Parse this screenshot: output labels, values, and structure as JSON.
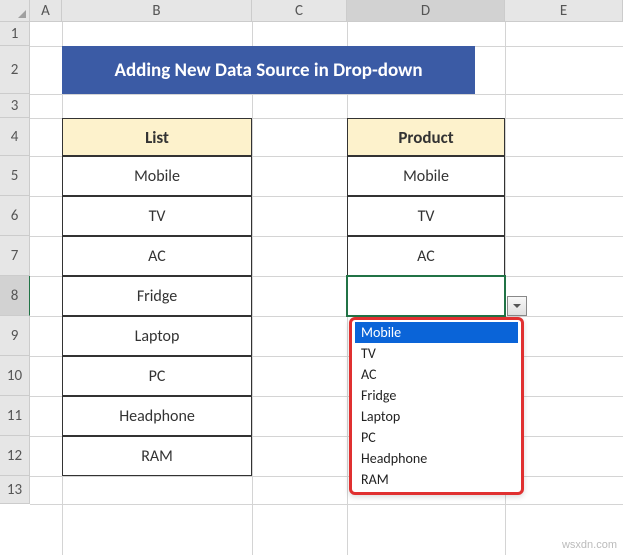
{
  "columns": {
    "A": "A",
    "B": "B",
    "C": "C",
    "D": "D",
    "E": "E"
  },
  "rows": {
    "r1": "1",
    "r2": "2",
    "r3": "3",
    "r4": "4",
    "r5": "5",
    "r6": "6",
    "r7": "7",
    "r8": "8",
    "r9": "9",
    "r10": "10",
    "r11": "11",
    "r12": "12",
    "r13": "13"
  },
  "banner": {
    "text": "Adding New Data Source in Drop-down"
  },
  "list": {
    "header": "List",
    "items": [
      "Mobile",
      "TV",
      "AC",
      "Fridge",
      "Laptop",
      "PC",
      "Headphone",
      "RAM"
    ]
  },
  "product": {
    "header": "Product",
    "items": [
      "Mobile",
      "TV",
      "AC"
    ]
  },
  "dropdown": {
    "options": [
      "Mobile",
      "TV",
      "AC",
      "Fridge",
      "Laptop",
      "PC",
      "Headphone",
      "RAM"
    ],
    "selected_index": 0
  },
  "watermark": "wsxdn.com"
}
